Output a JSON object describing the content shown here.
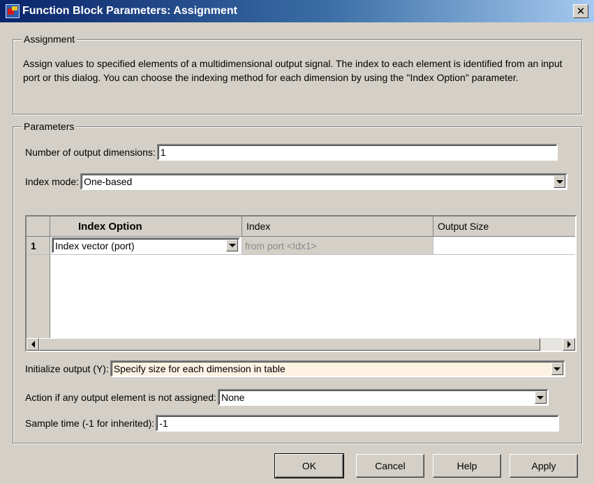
{
  "window": {
    "title": "Function Block Parameters: Assignment",
    "close_label": "✕"
  },
  "assignment_group": {
    "legend": "Assignment",
    "description": "Assign values to specified elements of a multidimensional output signal. The index to each element is identified from an input port or this dialog. You can choose the indexing method for each dimension by using the \"Index Option\" parameter."
  },
  "parameters_group": {
    "legend": "Parameters",
    "num_dims_label": "Number of output dimensions:",
    "num_dims_value": "1",
    "index_mode_label": "Index mode:",
    "index_mode_value": "One-based",
    "table": {
      "headers": [
        "Index Option",
        "Index",
        "Output Size"
      ],
      "rows": [
        {
          "num": "1",
          "index_option": "Index vector (port)",
          "index": "from port <Idx1>",
          "output_size": ""
        }
      ]
    },
    "init_output_label": "Initialize output (Y):",
    "init_output_value": "Specify size for each dimension in table",
    "action_label": "Action if any output element is not assigned:",
    "action_value": "None",
    "sample_time_label": "Sample time (-1 for inherited):",
    "sample_time_value": "-1"
  },
  "buttons": {
    "ok": "OK",
    "cancel": "Cancel",
    "help": "Help",
    "apply": "Apply"
  },
  "colors": {
    "title_gradient_start": "#0a246a",
    "title_gradient_end": "#a6caf0",
    "dialog_bg": "#d4d0c8",
    "highlight_field": "#fdf2e2"
  }
}
